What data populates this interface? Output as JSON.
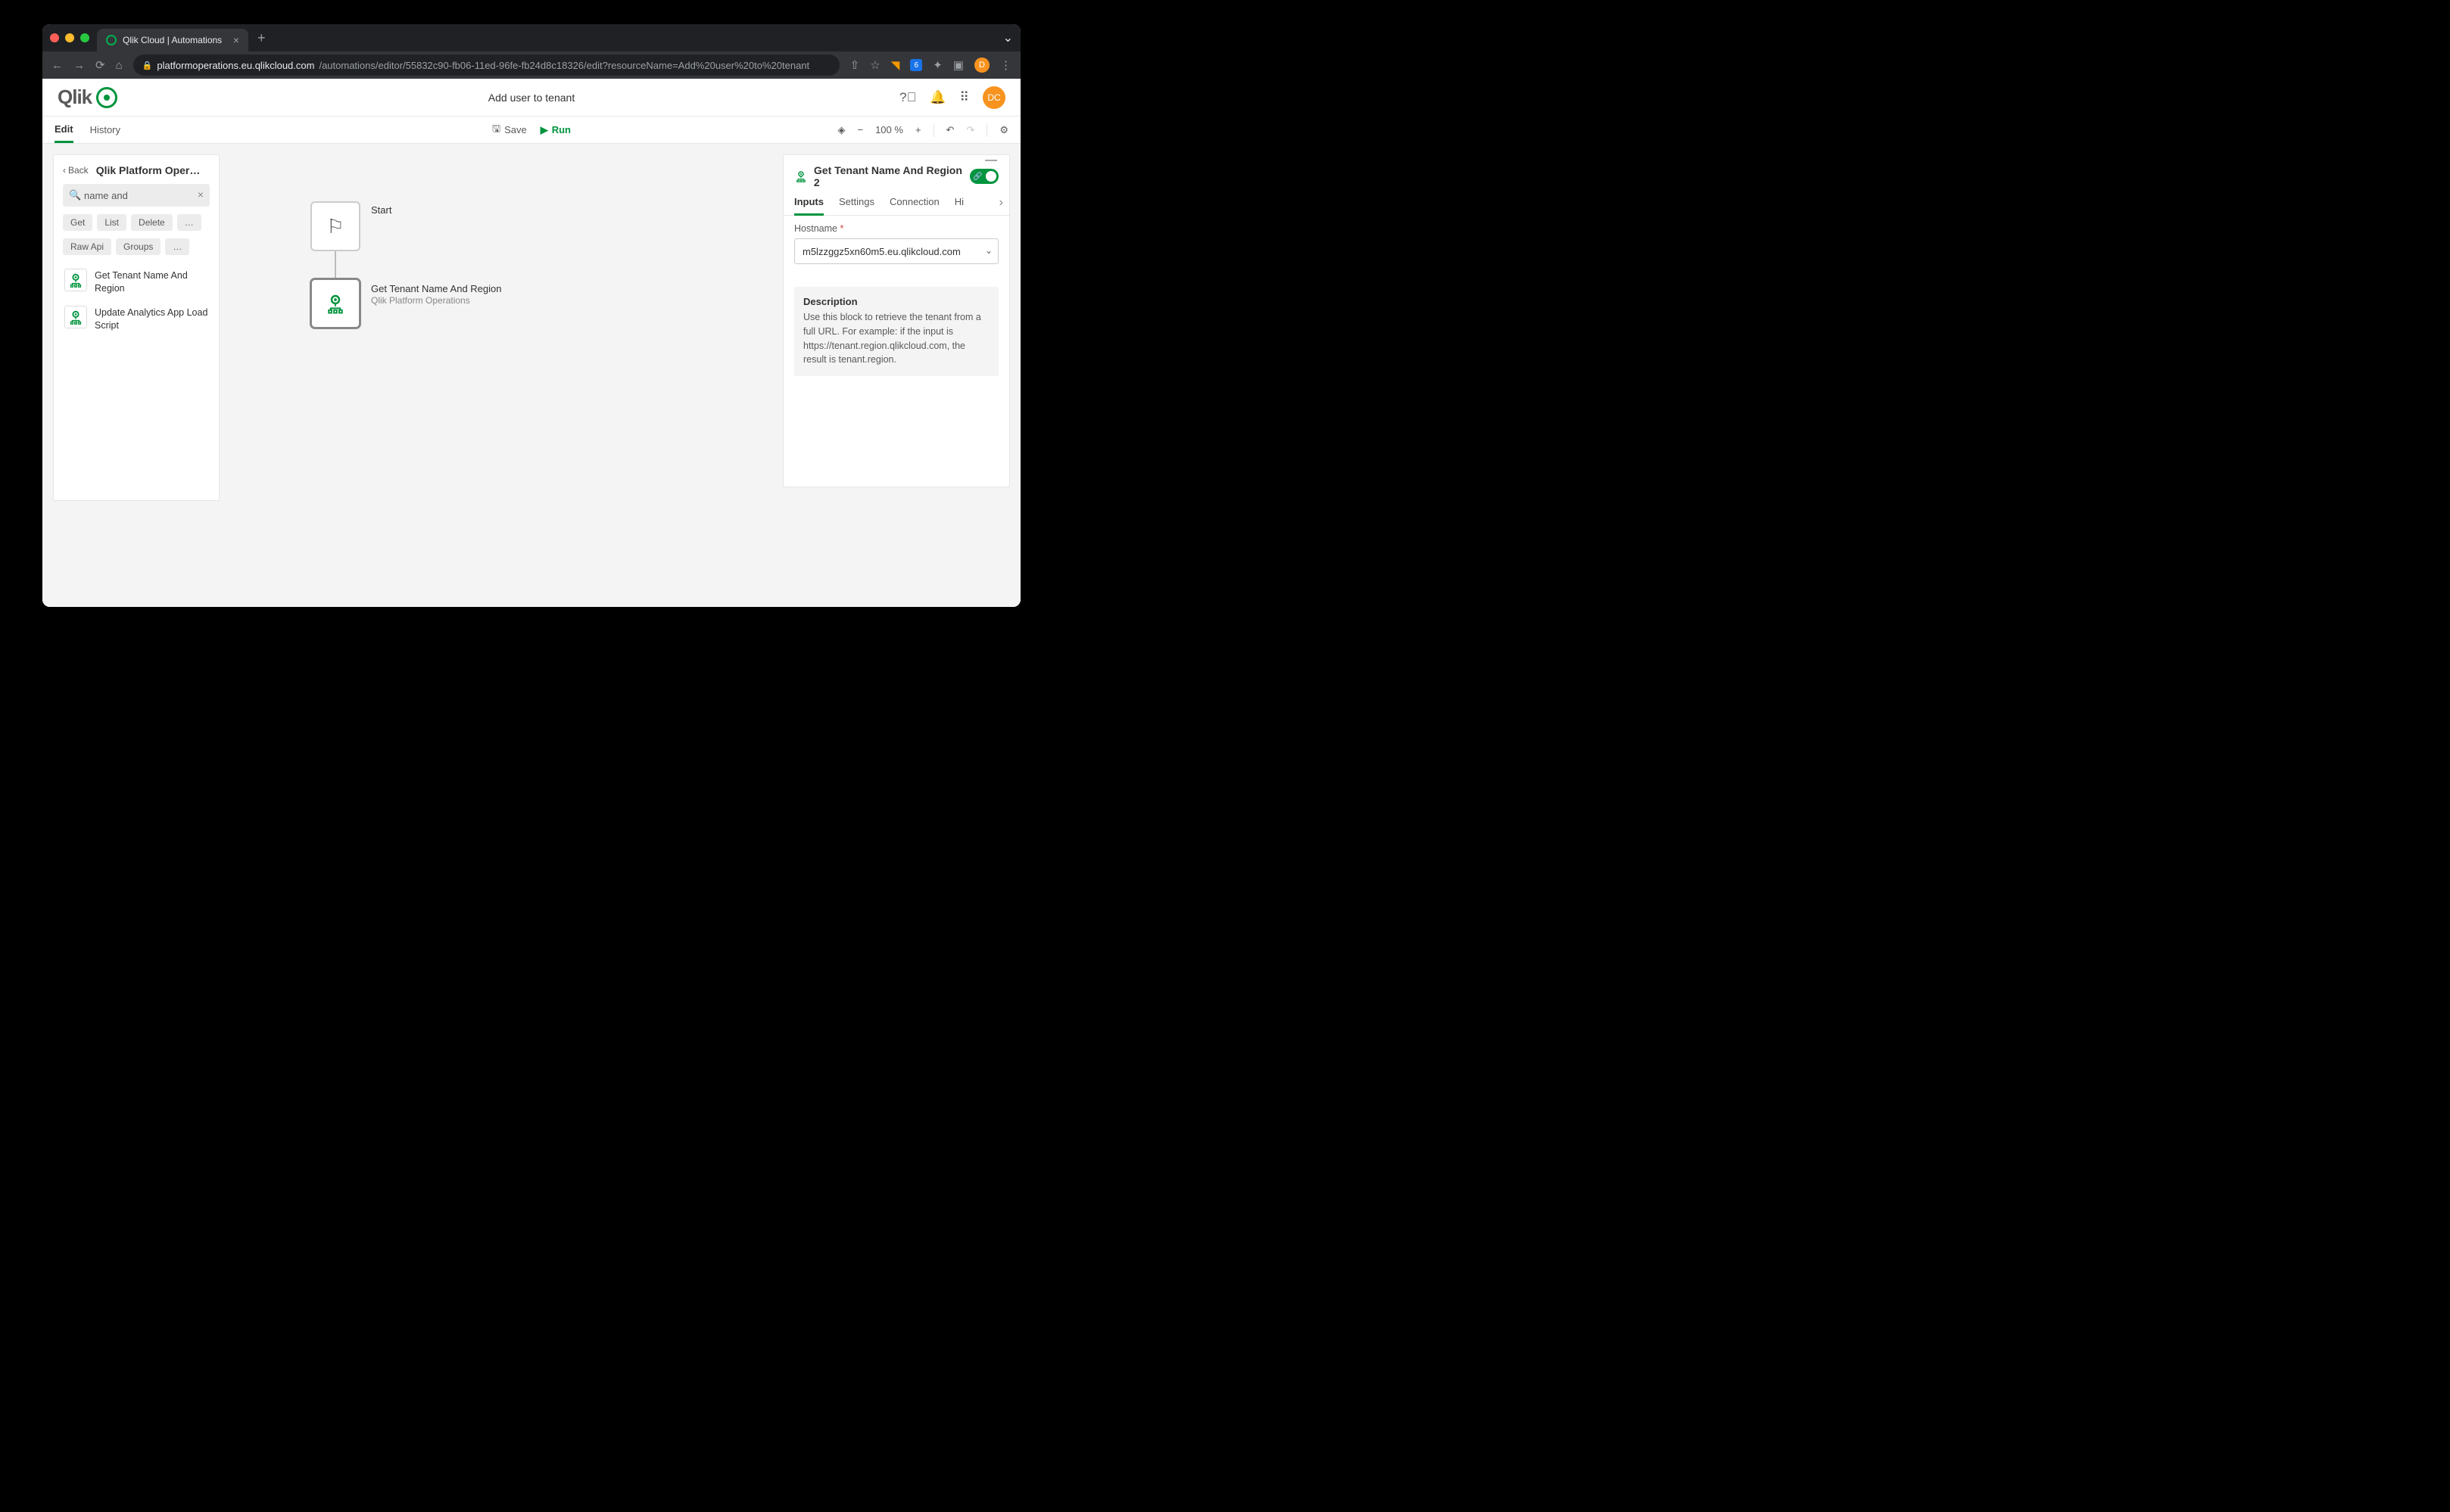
{
  "browser": {
    "tab_title": "Qlik Cloud | Automations",
    "url_host": "platformoperations.eu.qlikcloud.com",
    "url_path": "/automations/editor/55832c90-fb06-11ed-96fe-fb24d8c18326/edit?resourceName=Add%20user%20to%20tenant",
    "avatar": "D",
    "ext_badge": "6"
  },
  "app": {
    "header": {
      "logo_text": "Qlik",
      "title": "Add user to tenant",
      "avatar": "DC"
    },
    "toolbar": {
      "tabs": {
        "edit": "Edit",
        "history": "History"
      },
      "save": "Save",
      "run": "Run",
      "zoom": "100 %"
    },
    "left_panel": {
      "back": "Back",
      "title": "Qlik Platform Oper…",
      "search_value": "name and",
      "chips": [
        "Get",
        "List",
        "Delete",
        "…",
        "Raw Api",
        "Groups",
        "…"
      ],
      "items": [
        {
          "label": "Get Tenant Name And Region"
        },
        {
          "label": "Update Analytics App Load Script"
        }
      ]
    },
    "canvas": {
      "start_label": "Start",
      "block": {
        "title": "Get Tenant Name And Region",
        "subtitle": "Qlik Platform Operations"
      }
    },
    "right_panel": {
      "title": "Get Tenant Name And Region 2",
      "tabs": {
        "inputs": "Inputs",
        "settings": "Settings",
        "connection": "Connection",
        "hi": "Hi"
      },
      "hostname_label": "Hostname",
      "hostname_value": "m5lzzggz5xn60m5.eu.qlikcloud.com",
      "desc_title": "Description",
      "desc_text": "Use this block to retrieve the tenant from a full URL. For example: if the input is https://tenant.region.qlikcloud.com, the result is tenant.region."
    }
  }
}
